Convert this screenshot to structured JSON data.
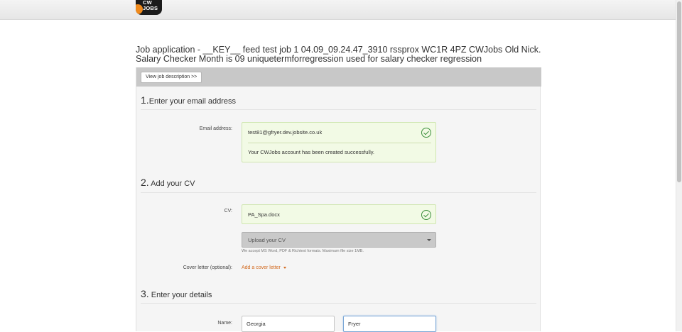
{
  "header": {
    "logo_text": "CW\nJOBS"
  },
  "page": {
    "title_line1": "Job application - __KEY__ feed test job 1 04.09_09.24.47_3910 rssprox WC1R 4PZ CWJobs Old Nick.",
    "title_line2": "Salary Checker Month is 09 uniquetermforregression used for salary checker regression",
    "view_job_button": "View job description >>"
  },
  "section1": {
    "number": "1.",
    "title": "Enter your email address",
    "email_label": "Email address:",
    "email_value": "test81@gfryer.dev.jobsite.co.uk",
    "success_message": "Your CWJobs account has been created successfully."
  },
  "section2": {
    "number": "2.",
    "title": "Add your CV",
    "cv_label": "CV:",
    "cv_value": "PA_Spa.docx",
    "upload_label": "Upload your CV",
    "hint": "We accept MS Word, PDF & Richtext formats. Maximum file size 1MB.",
    "cover_label": "Cover letter (optional):",
    "cover_link": "Add a cover letter"
  },
  "section3": {
    "number": "3.",
    "title": "Enter your details",
    "name_label": "Name:",
    "first_name": "Georgia",
    "last_name": "Fryer"
  },
  "colors": {
    "accent_link": "#d2691e",
    "success_bg": "#f2fae5",
    "success_check": "#3c8f3c",
    "panel_header": "#c8c8c8"
  }
}
